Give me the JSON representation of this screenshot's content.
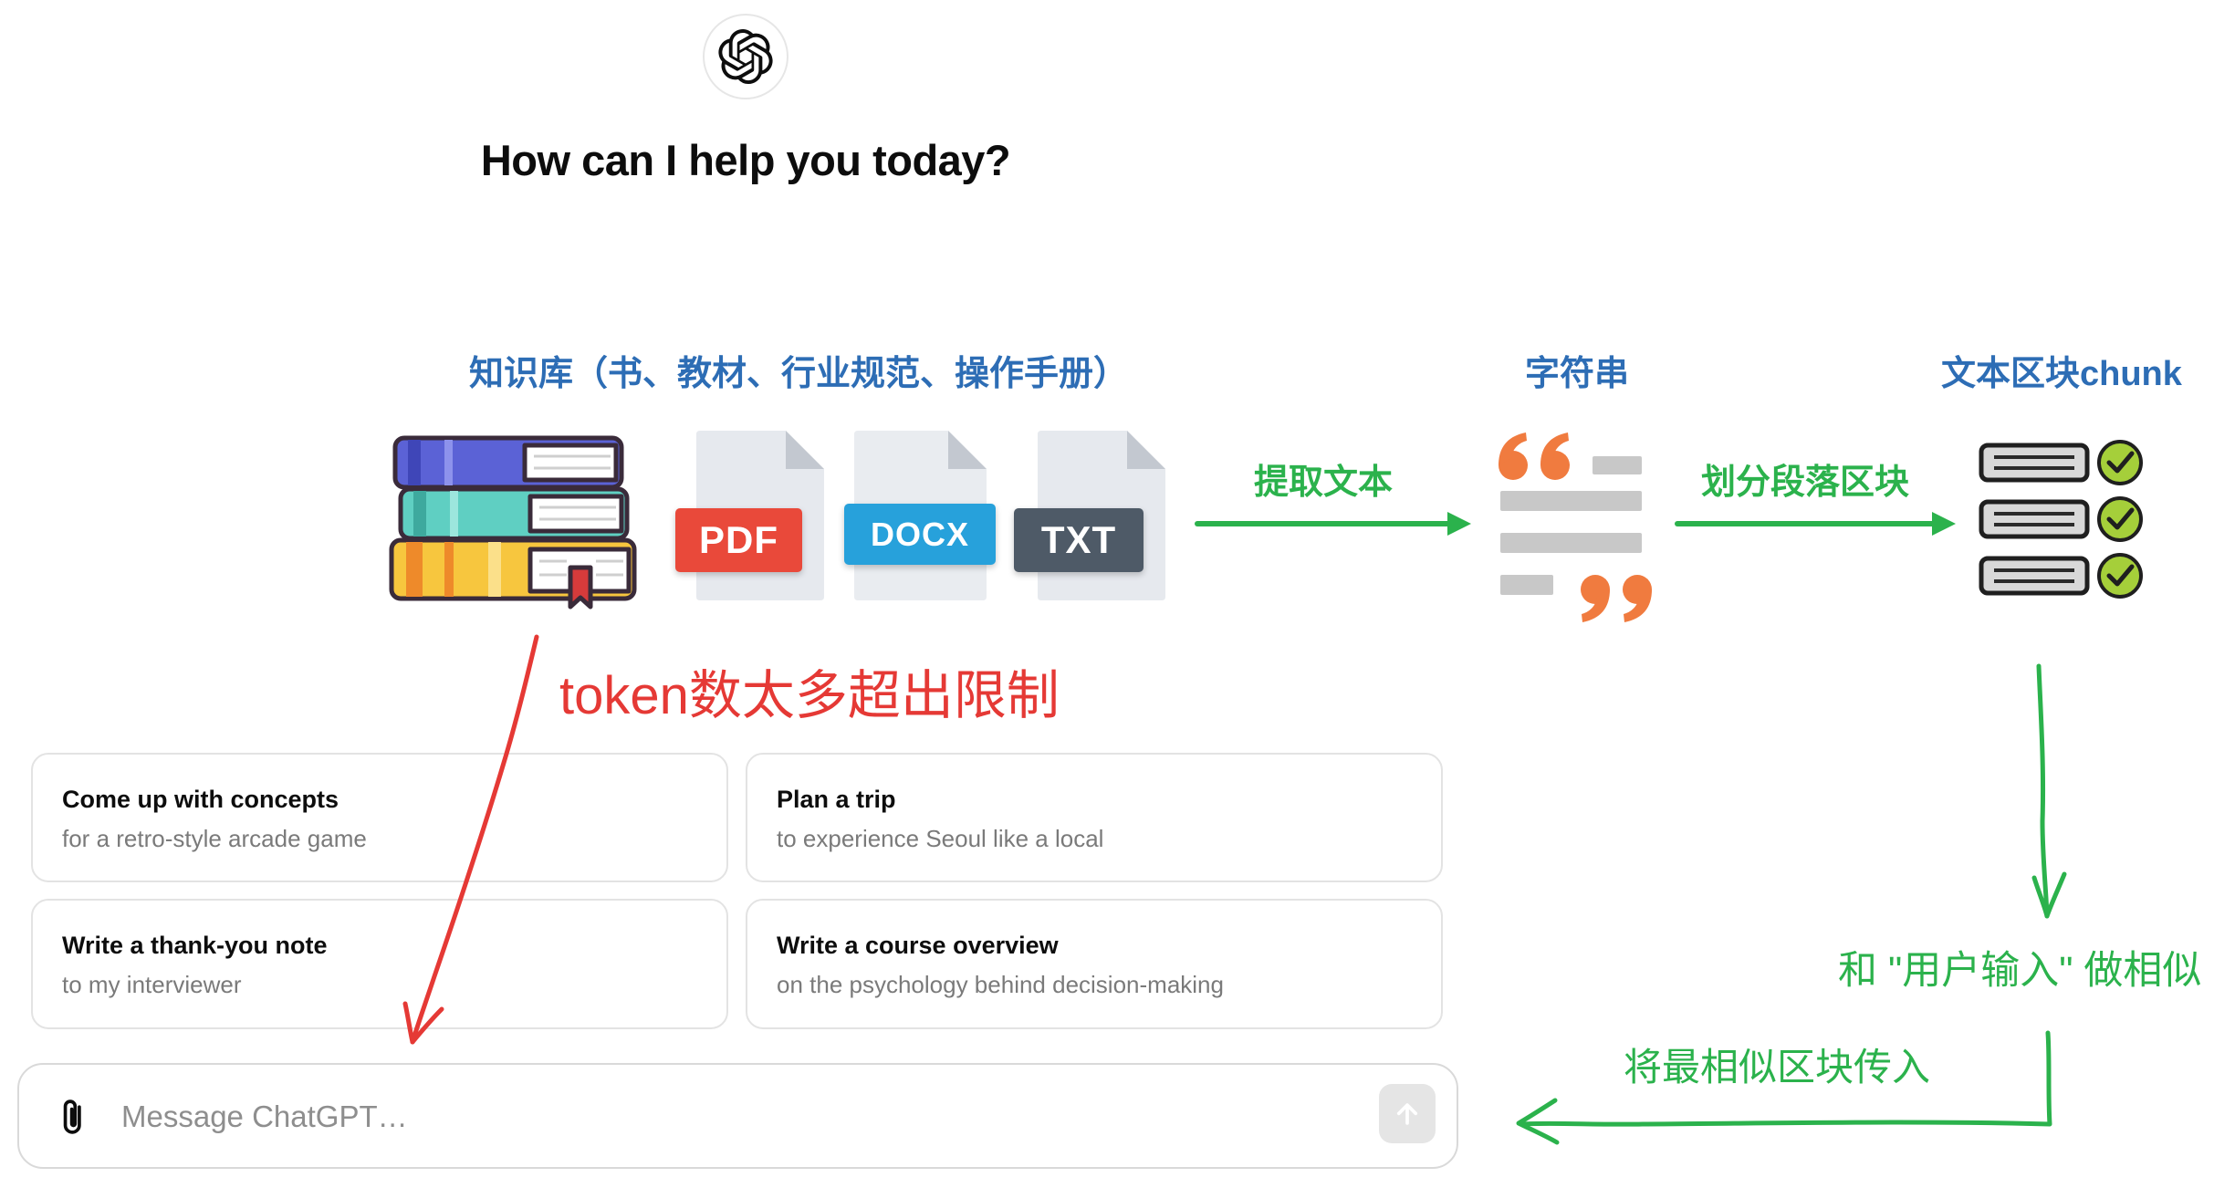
{
  "app": {
    "greeting": "How can I help you today?"
  },
  "diagram": {
    "knowledge_base_label": "知识库（书、教材、行业规范、操作手册）",
    "string_label": "字符串",
    "chunk_label": "文本区块chunk",
    "files": [
      {
        "label": "PDF"
      },
      {
        "label": "DOCX"
      },
      {
        "label": "TXT"
      }
    ],
    "extract_text_label": "提取文本",
    "split_chunks_label": "划分段落区块",
    "token_limit_warning": "token数太多超出限制",
    "similarity_label": "和 \"用户输入\" 做相似",
    "pass_chunks_label": "将最相似区块传入"
  },
  "suggestions": [
    {
      "title": "Come up with concepts",
      "subtitle": "for a retro-style arcade game"
    },
    {
      "title": "Plan a trip",
      "subtitle": "to experience Seoul like a local"
    },
    {
      "title": "Write a thank-you note",
      "subtitle": "to my interviewer"
    },
    {
      "title": "Write a course overview",
      "subtitle": "on the psychology behind decision-making"
    }
  ],
  "composer": {
    "placeholder": "Message ChatGPT…"
  },
  "colors": {
    "diagram_blue": "#2d6db5",
    "arrow_green": "#2bb24c",
    "annotation_red": "#e53935",
    "pdf": "#e9493a",
    "docx": "#27a1db",
    "txt": "#4e5a67",
    "accent_orange": "#f07b3f",
    "check_green": "#a5cf3a"
  },
  "icons": {
    "logo": "openai-logo-icon",
    "attach": "paperclip-icon",
    "send": "arrow-up-icon",
    "books": "books-icon",
    "document": "document-file-icon",
    "text": "quote-text-icon",
    "chunks": "chunk-list-icon"
  }
}
